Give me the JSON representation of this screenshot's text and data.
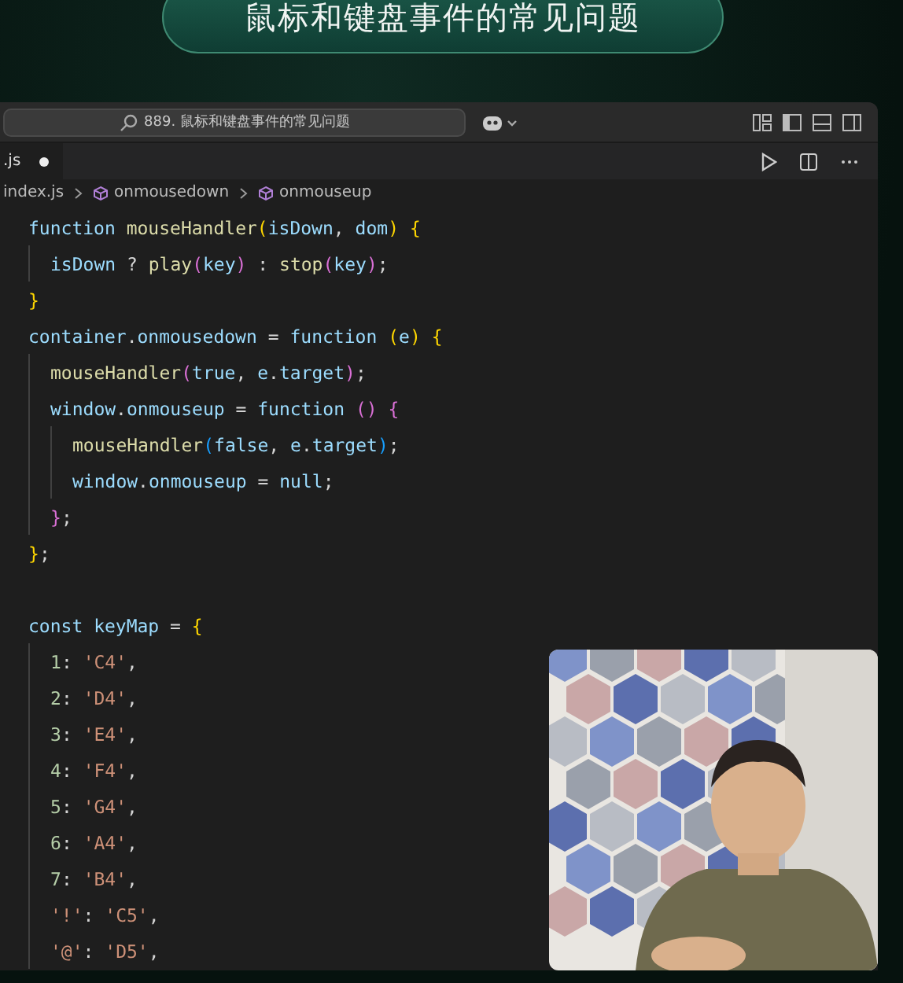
{
  "banner": {
    "title": "鼠标和键盘事件的常见问题"
  },
  "editor": {
    "search": "889. 鼠标和键盘事件的常见问题",
    "tab": {
      "label": ".js",
      "modified": true
    },
    "breadcrumb": [
      "index.js",
      "onmousedown",
      "onmouseup"
    ],
    "code": [
      {
        "kind": "code",
        "line": "function mouseHandler(isDown, dom) {",
        "children": [
          {
            "kind": "code",
            "line": "isDown ? play(key) : stop(key);"
          }
        ]
      },
      {
        "kind": "code",
        "line": "}"
      },
      {
        "kind": "code",
        "line": "container.onmousedown = function (e) {",
        "children": [
          {
            "kind": "code",
            "line": "mouseHandler(true, e.target);"
          },
          {
            "kind": "code",
            "line": "window.onmouseup = function () {",
            "children": [
              {
                "kind": "code",
                "line": "mouseHandler(false, e.target);"
              },
              {
                "kind": "code",
                "line": "window.onmouseup = null;"
              }
            ]
          },
          {
            "kind": "code",
            "line": "};"
          }
        ]
      },
      {
        "kind": "code",
        "line": "};"
      },
      {
        "kind": "blank"
      },
      {
        "kind": "code",
        "line": "const keyMap = {",
        "children": [
          {
            "kind": "code",
            "line": "1: 'C4',"
          },
          {
            "kind": "code",
            "line": "2: 'D4',"
          },
          {
            "kind": "code",
            "line": "3: 'E4',"
          },
          {
            "kind": "code",
            "line": "4: 'F4',"
          },
          {
            "kind": "code",
            "line": "5: 'G4',"
          },
          {
            "kind": "code",
            "line": "6: 'A4',"
          },
          {
            "kind": "code",
            "line": "7: 'B4',"
          },
          {
            "kind": "code",
            "line": "'!': 'C5',"
          },
          {
            "kind": "code",
            "line": "'@': 'D5',"
          }
        ]
      }
    ]
  }
}
